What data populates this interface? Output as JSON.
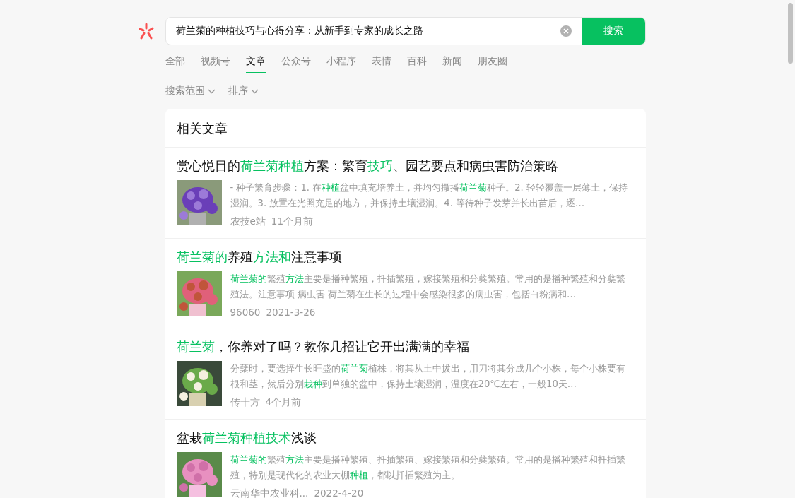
{
  "search": {
    "value": "荷兰菊的种植技巧与心得分享：从新手到专家的成长之路",
    "button": "搜索"
  },
  "tabs": [
    {
      "label": "全部",
      "selected": false
    },
    {
      "label": "视频号",
      "selected": false
    },
    {
      "label": "文章",
      "selected": true
    },
    {
      "label": "公众号",
      "selected": false
    },
    {
      "label": "小程序",
      "selected": false
    },
    {
      "label": "表情",
      "selected": false
    },
    {
      "label": "百科",
      "selected": false
    },
    {
      "label": "新闻",
      "selected": false
    },
    {
      "label": "朋友圈",
      "selected": false
    }
  ],
  "filters": [
    "搜索范围",
    "排序"
  ],
  "section_title": "相关文章",
  "articles": [
    {
      "title": "赏心悦目的**荷兰菊种植**方案：繁育**技巧**、园艺要点和病虫害防治策略",
      "snippet": "- 种子繁育步骤：1. 在**种植**盆中填充培养土，并均匀撒播**荷兰菊**种子。2. 轻轻覆盖一层薄土，保持湿润。3. 放置在光照充足的地方，并保持土壤湿润。4. 等待种子发芽并长出苗后，逐…",
      "source": "农技e站",
      "time": "11个月前",
      "kind": "purple"
    },
    {
      "title": "**荷兰菊的**养殖**方法和**注意事项",
      "snippet": "**荷兰菊的**繁殖**方法**主要是播种繁殖，扦插繁殖，嫁接繁殖和分蘖繁殖。常用的是播种繁殖和分蘖繁殖法。注意事项 病虫害 荷兰菊在生长的过程中会感染很多的病虫害，包括白粉病和…",
      "source": "96060",
      "time": "2021-3-26",
      "kind": "garden"
    },
    {
      "title": "**荷兰菊**，你养对了吗？教你几招让它开出满满的幸福",
      "snippet": "分蘖时，要选择生长旺盛的**荷兰菊**植株，将其从土中拔出，用刀将其分成几个小株，每个小株要有根和茎，然后分别**栽种**到单独的盆中，保持土壤湿润，温度在20℃左右，一般10天…",
      "source": "传十方",
      "time": "4个月前",
      "kind": "bulb"
    },
    {
      "title": "盆栽**荷兰菊种植技术**浅谈",
      "snippet": "**荷兰菊的**繁殖**方法**主要是播种繁殖、扦插繁殖、嫁接繁殖和分蘖繁殖。常用的是播种繁殖和扦插繁殖，特别是现代化的农业大棚**种植**，都以扦插繁殖为主。",
      "source": "云南华中农业科...",
      "time": "2022-4-20",
      "kind": "pink"
    }
  ]
}
